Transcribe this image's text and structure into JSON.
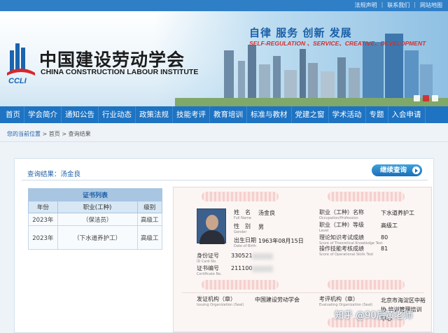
{
  "top_links": [
    "法规声明",
    "联系我们",
    "网站地图"
  ],
  "logo": {
    "chinese": "中国建设劳动学会",
    "english": "CHINA CONSTRUCTION LABOUR INSTITUTE",
    "abbr": "CCLI"
  },
  "slogan": {
    "chinese": "自律 服务 创新 发展",
    "english": "SELF-REGULATION 、SERVICE、CREATIVE、DEVELOPMENT"
  },
  "nav": [
    "首页",
    "学会简介",
    "通知公告",
    "行业动态",
    "政策法规",
    "技能考评",
    "教育培训",
    "标准与教材",
    "党建之窗",
    "学术活动",
    "专题",
    "入会申请"
  ],
  "breadcrumb": {
    "here": "您的当前位置",
    "sep": " > ",
    "home": "首页",
    "page": "查询结果"
  },
  "result": {
    "title": "查询结果：汤金良",
    "continue_label": "继续查询"
  },
  "cert_list": {
    "caption": "证书列表",
    "columns": [
      "年份",
      "职业(工种)",
      "级别"
    ],
    "rows": [
      [
        "2023年",
        "（保洁员）",
        "高级工"
      ],
      [
        "2023年",
        "（下水道养护工）",
        "高级工"
      ]
    ]
  },
  "certificate": {
    "name": {
      "label": "姓　名",
      "sub": "Full Name",
      "value": "汤金良"
    },
    "gender": {
      "label": "性　别",
      "sub": "Gender",
      "value": "男"
    },
    "birth": {
      "label": "出生日期",
      "sub": "Date of Birth",
      "value": "1963年08月15日"
    },
    "id_no": {
      "label": "身份证号",
      "sub": "ID Card No.",
      "value": "330521"
    },
    "cert_no": {
      "label": "证书编号",
      "sub": "Certificate No.",
      "value": "211100"
    },
    "occupation": {
      "label": "职业（工种）名称",
      "sub": "Occupation/Profession",
      "value": "下水道养护工"
    },
    "level": {
      "label": "职业（工种）等级",
      "sub": "Level",
      "value": "高级工"
    },
    "theory": {
      "label": "理论知识考试成绩",
      "sub": "Score of Theoretical Knowledge Test",
      "value": "80"
    },
    "skill": {
      "label": "操作技能考核成绩",
      "sub": "Score of Operational Skills Test",
      "value": "81"
    },
    "issuing": {
      "label": "发证机构（章）",
      "sub": "Issuing Organization (Seal)",
      "value": "中国建设劳动学会"
    },
    "evaluating": {
      "label": "考评机构（章）",
      "sub": "Evaluating Organization (Seal)",
      "value": "北京市海淀区中裕协 培训管理培训中心"
    }
  },
  "watermark": "知乎 @90后黄老师"
}
